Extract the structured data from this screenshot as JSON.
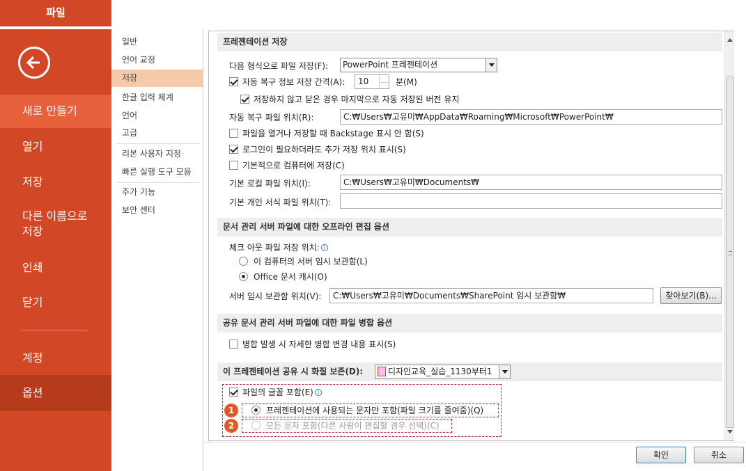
{
  "sidebar": {
    "file_tab": "파일",
    "items": [
      {
        "label": "새로 만들기"
      },
      {
        "label": "열기"
      },
      {
        "label": "저장"
      },
      {
        "label": "다른 이름으로\n저장"
      },
      {
        "label": "인쇄"
      },
      {
        "label": "닫기"
      },
      {
        "label": "계정"
      },
      {
        "label": "옵션"
      }
    ]
  },
  "categories": [
    "일반",
    "언어 교정",
    "저장",
    "한글 입력 체계",
    "언어",
    "고급",
    "리본 사용자 지정",
    "빠른 실행 도구 모음",
    "추가 기능",
    "보안 센터"
  ],
  "save": {
    "section_title": "프레젠테이션 저장",
    "format_label": "다음 형식으로 파일 저장(F):",
    "format_value": "PowerPoint 프레젠테이션",
    "autorecover_label": "자동 복구 정보 저장 간격(A):",
    "autorecover_value": "10",
    "autorecover_unit": "분(M)",
    "keep_version_label": "저장하지 않고 닫은 경우 마지막으로 자동 저장된 버전 유지",
    "autorecover_loc_label": "자동 복구 파일 위치(R):",
    "autorecover_loc_value": "C:₩Users₩고유미₩AppData₩Roaming₩Microsoft₩PowerPoint₩",
    "no_backstage_label": "파일을 열거나 저장할 때 Backstage 표시 안 함(S)",
    "signin_label": "로그인이 필요하더라도 추가 저장 위치 표시(S)",
    "default_computer_label": "기본적으로 컴퓨터에 저장(C)",
    "local_loc_label": "기본 로컬 파일 위치(I):",
    "local_loc_value": "C:₩Users₩고유미₩Documents₩",
    "template_loc_label": "기본 개인 서식 파일 위치(T):",
    "template_loc_value": ""
  },
  "offline": {
    "section_title": "문서 관리 서버 파일에 대한 오프라인 편집 옵션",
    "checkout_label": "체크 아웃 파일 저장 위치:",
    "radio_server": "이 컴퓨터의 서버 임시 보관함(L)",
    "radio_cache": "Office 문서 캐시(O)",
    "server_drafts_label": "서버 임시 보관함 위치(V):",
    "server_drafts_value": "C:₩Users₩고유미₩Documents₩SharePoint 임시 보관함₩",
    "browse_label": "찾아보기(B)..."
  },
  "merge": {
    "section_title": "공유 문서 관리 서버 파일에 대한 파일 병합 옵션",
    "show_changes_label": "병합 발생 시 자세한 병합 변경 내용 표시(S)"
  },
  "fidelity": {
    "section_title": "이 프레젠테이션 공유 시 화질 보존(D):",
    "file_value": "디자인교육_실습_1130부터1",
    "embed_fonts_label": "파일의 글꼴 포함(E)",
    "radio_used": "프레젠테이션에 사용되는 문자만 포함(파일 크기를 줄여줌)(Q)",
    "radio_all": "모든 문자 포함(다른 사람이 편집할 경우 선택)(C)",
    "badge1": "1",
    "badge2": "2"
  },
  "footer": {
    "ok_label": "확인",
    "cancel_label": "취소"
  }
}
